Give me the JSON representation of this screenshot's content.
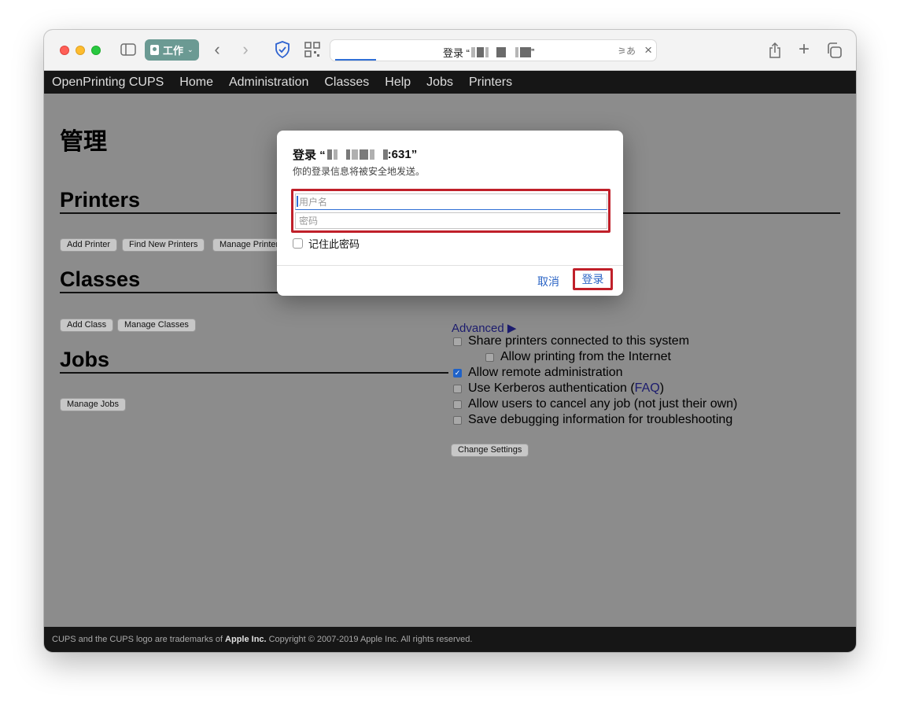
{
  "toolbar": {
    "profile_label": "工作",
    "address_title_prefix": "登录 “",
    "address_title_suffix": "”"
  },
  "cups_nav": [
    "OpenPrinting CUPS",
    "Home",
    "Administration",
    "Classes",
    "Help",
    "Jobs",
    "Printers"
  ],
  "page": {
    "title": "管理",
    "printers_heading": "Printers",
    "printers_buttons": [
      "Add Printer",
      "Find New Printers",
      "Manage Printers"
    ],
    "classes_heading": "Classes",
    "classes_buttons": [
      "Add Class",
      "Manage Classes"
    ],
    "jobs_heading": "Jobs",
    "jobs_buttons": [
      "Manage Jobs"
    ],
    "advanced_label": "Advanced ▶",
    "options": [
      {
        "label": "Share printers connected to this system",
        "checked": false
      },
      {
        "label": "Allow printing from the Internet",
        "checked": false
      },
      {
        "label": "Allow remote administration",
        "checked": true
      },
      {
        "label": "Use Kerberos authentication (",
        "link": "FAQ",
        "suffix": ")",
        "checked": false
      },
      {
        "label": "Allow users to cancel any job (not just their own)",
        "checked": false
      },
      {
        "label": "Save debugging information for troubleshooting",
        "checked": false
      }
    ],
    "change_settings": "Change Settings"
  },
  "footer": {
    "prefix": "CUPS and the CUPS logo are trademarks of",
    "company": "Apple Inc.",
    "suffix": "Copyright © 2007-2019 Apple Inc. All rights reserved."
  },
  "dialog": {
    "title_prefix": "登录 “",
    "title_port": ":631”",
    "subtitle": "你的登录信息将被安全地发送。",
    "username_placeholder": "用户名",
    "password_placeholder": "密码",
    "remember_label": "记住此密码",
    "cancel_label": "取消",
    "login_label": "登录"
  },
  "colors": {
    "highlight_red": "#c0202a",
    "link_blue": "#2b64c5",
    "nav_bg": "#161616",
    "overlay_gray": "#8c8c8c"
  }
}
